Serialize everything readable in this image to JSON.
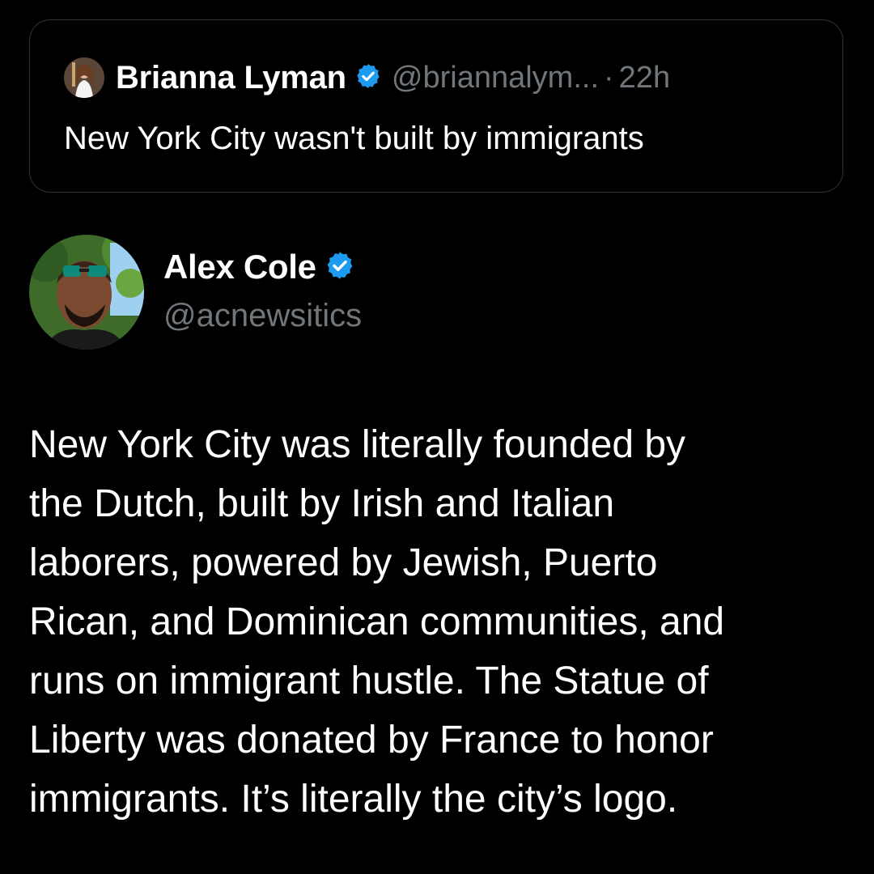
{
  "quoted_tweet": {
    "author_name": "Brianna Lyman",
    "author_handle": "@briannalym...",
    "separator": "·",
    "timestamp": "22h",
    "text": "New York City wasn't built by immigrants",
    "verified_icon": "verified-badge-icon"
  },
  "tweet": {
    "author_name": "Alex Cole",
    "author_handle": "@acnewsitics",
    "verified_icon": "verified-badge-icon",
    "body_lines": [
      "New York City was literally founded by",
      "the Dutch, built by Irish and Italian",
      "laborers, powered by Jewish, Puerto",
      "Rican, and Dominican communities, and",
      "runs on immigrant hustle. The Statue of",
      "Liberty was donated by France to honor",
      "immigrants. It’s literally the city’s logo."
    ]
  },
  "colors": {
    "background": "#000000",
    "text_primary": "#ffffff",
    "text_secondary": "#71767b",
    "border": "#2f3336",
    "verified_blue": "#1d9bf0"
  }
}
